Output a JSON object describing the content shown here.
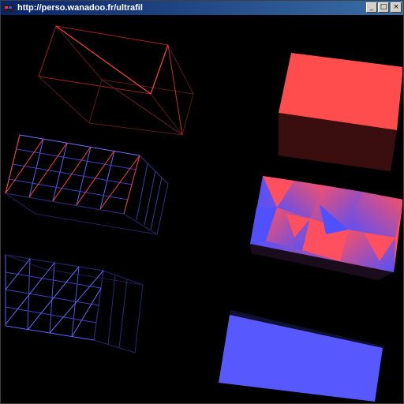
{
  "window": {
    "title": "http://perso.wanadoo.fr/ultrafil",
    "controls": {
      "minimize": "_",
      "maximize": "□",
      "close": "×"
    }
  },
  "scene": {
    "objects": [
      {
        "name": "wireframe-box-red",
        "style": "wireframe",
        "color": "#ff4a4a"
      },
      {
        "name": "wireframe-box-redblue-grid",
        "style": "wireframe-grid",
        "color": "#ff5050"
      },
      {
        "name": "wireframe-box-blue-grid",
        "style": "wireframe-grid",
        "color": "#6060ff"
      },
      {
        "name": "solid-box-red",
        "style": "flat-shaded",
        "color": "#ff4c4c"
      },
      {
        "name": "solid-box-gradient",
        "style": "gradient-shaded",
        "color": "#ff5060"
      },
      {
        "name": "solid-box-blue",
        "style": "flat-shaded",
        "color": "#5858ff"
      }
    ]
  },
  "colors": {
    "titlebar_start": "#0a246a",
    "titlebar_end": "#3a6ea5",
    "background": "#000000",
    "red": "#ff4c4c",
    "blue": "#5858ff"
  }
}
